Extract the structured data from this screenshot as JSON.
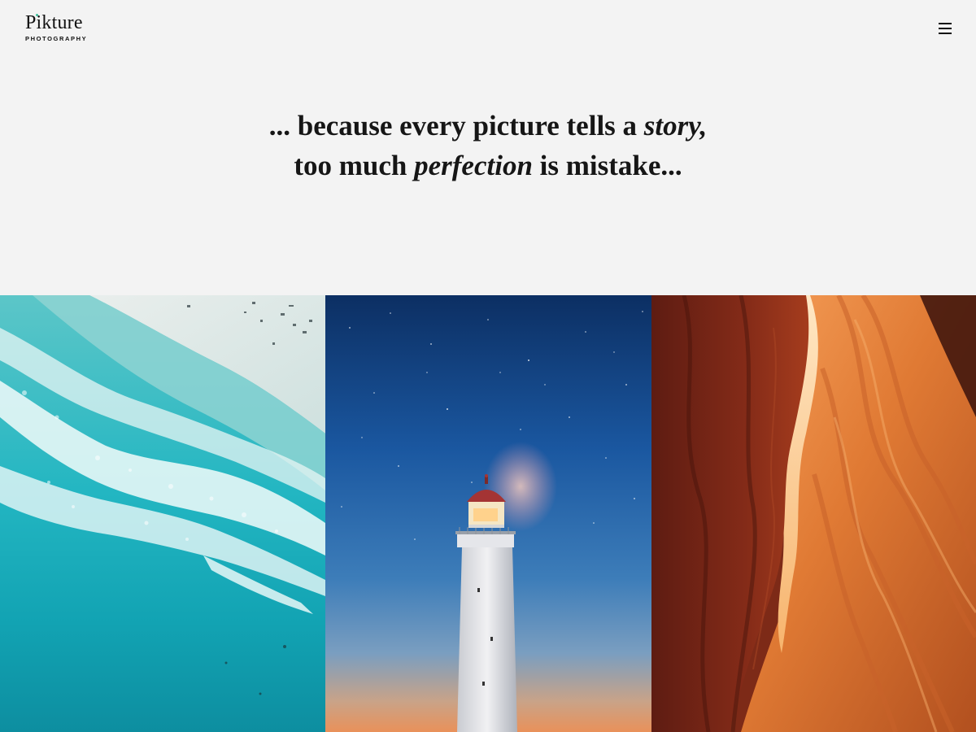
{
  "header": {
    "logo_word": "Pikture",
    "logo_subtitle": "PHOTOGRAPHY",
    "menu_icon": "hamburger-menu-icon"
  },
  "tagline": {
    "line1_before": "... because every picture tells a ",
    "line1_emphasis": "story,",
    "line2_before": "too much ",
    "line2_emphasis": "perfection",
    "line2_after": " is mistake..."
  },
  "gallery": {
    "photos": [
      {
        "subject": "aerial ocean waves beach"
      },
      {
        "subject": "lighthouse under starry night sky"
      },
      {
        "subject": "red sandstone slot canyon"
      }
    ]
  },
  "colors": {
    "background": "#f3f3f3",
    "text": "#111111",
    "logo_accent": "#3dbf9a"
  }
}
